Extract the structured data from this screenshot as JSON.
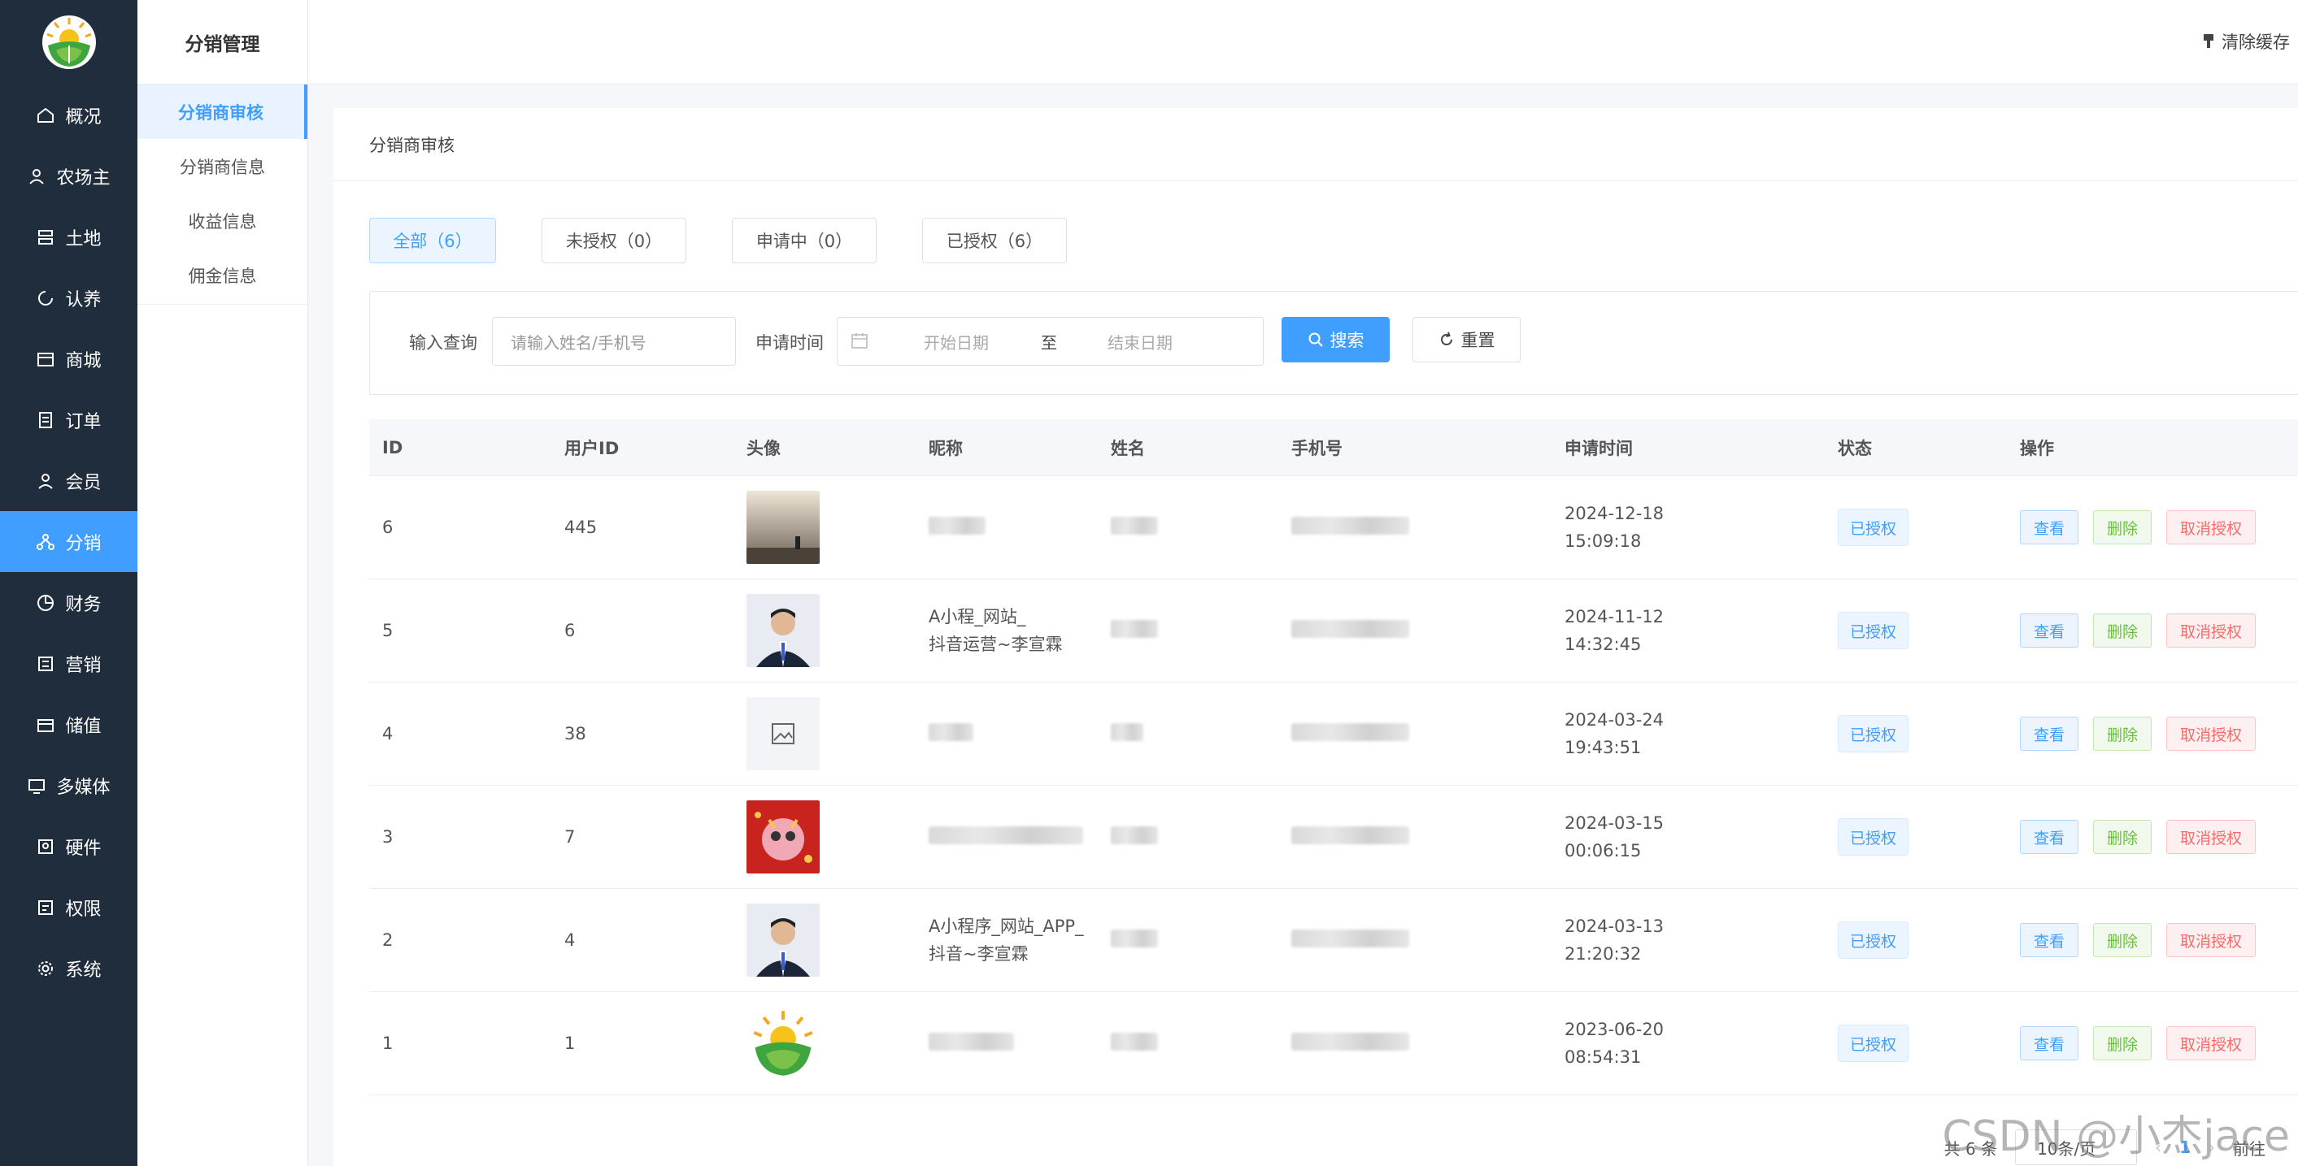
{
  "sidebar": {
    "items": [
      {
        "label": "概况",
        "icon": "home-icon"
      },
      {
        "label": "农场主",
        "icon": "user-icon"
      },
      {
        "label": "土地",
        "icon": "land-icon"
      },
      {
        "label": "认养",
        "icon": "adopt-icon"
      },
      {
        "label": "商城",
        "icon": "store-icon"
      },
      {
        "label": "订单",
        "icon": "order-icon"
      },
      {
        "label": "会员",
        "icon": "member-icon"
      },
      {
        "label": "分销",
        "icon": "distribution-icon"
      },
      {
        "label": "财务",
        "icon": "finance-icon"
      },
      {
        "label": "营销",
        "icon": "marketing-icon"
      },
      {
        "label": "储值",
        "icon": "wallet-icon"
      },
      {
        "label": "多媒体",
        "icon": "media-icon"
      },
      {
        "label": "硬件",
        "icon": "hardware-icon"
      },
      {
        "label": "权限",
        "icon": "permission-icon"
      },
      {
        "label": "系统",
        "icon": "gear-icon"
      }
    ],
    "active_index": 7
  },
  "submenu": {
    "title": "分销管理",
    "items": [
      "分销商审核",
      "分销商信息",
      "收益信息",
      "佣金信息"
    ]
  },
  "header": {
    "clear_cache": "清除缓存"
  },
  "page": {
    "title": "分销商审核"
  },
  "tabs": [
    {
      "label": "全部（6）"
    },
    {
      "label": "未授权（0）"
    },
    {
      "label": "申请中（0）"
    },
    {
      "label": "已授权（6）"
    }
  ],
  "search": {
    "query_label": "输入查询",
    "query_placeholder": "请输入姓名/手机号",
    "date_label": "申请时间",
    "start_placeholder": "开始日期",
    "range_sep": "至",
    "end_placeholder": "结束日期",
    "search_button": "搜索",
    "reset_button": "重置"
  },
  "table": {
    "headers": [
      "ID",
      "用户ID",
      "头像",
      "昵称",
      "姓名",
      "手机号",
      "申请时间",
      "状态",
      "操作"
    ],
    "rows": [
      {
        "id": "6",
        "user_id": "445",
        "avatar": "landscape-photo",
        "nickname": "",
        "date": "2024-12-18",
        "time": "15:09:18",
        "status": "已授权"
      },
      {
        "id": "5",
        "user_id": "6",
        "avatar": "man-portrait",
        "nickname": "A小程_网站_\n抖音运营~李宣霖",
        "date": "2024-11-12",
        "time": "14:32:45",
        "status": "已授权"
      },
      {
        "id": "4",
        "user_id": "38",
        "avatar": "image-placeholder",
        "nickname": "",
        "date": "2024-03-24",
        "time": "19:43:51",
        "status": "已授权"
      },
      {
        "id": "3",
        "user_id": "7",
        "avatar": "dragon-cartoon",
        "nickname": "",
        "date": "2024-03-15",
        "time": "00:06:15",
        "status": "已授权"
      },
      {
        "id": "2",
        "user_id": "4",
        "avatar": "man-portrait",
        "nickname": "A小程序_网站_APP_\n抖音~李宣霖",
        "date": "2024-03-13",
        "time": "21:20:32",
        "status": "已授权"
      },
      {
        "id": "1",
        "user_id": "1",
        "avatar": "leaf-logo",
        "nickname": "",
        "date": "2023-06-20",
        "time": "08:54:31",
        "status": "已授权"
      }
    ],
    "actions": {
      "view": "查看",
      "delete": "删除",
      "cancel": "取消授权"
    }
  },
  "pagination": {
    "total": "共 6 条",
    "page_size": "10条/页",
    "current": "1",
    "goto": "前往"
  },
  "watermark": "CSDN @小杰jace",
  "colors": {
    "primary": "#409eff",
    "sidebar_bg": "#1f2d3d",
    "success": "#67c23a",
    "danger": "#f56c6c"
  }
}
